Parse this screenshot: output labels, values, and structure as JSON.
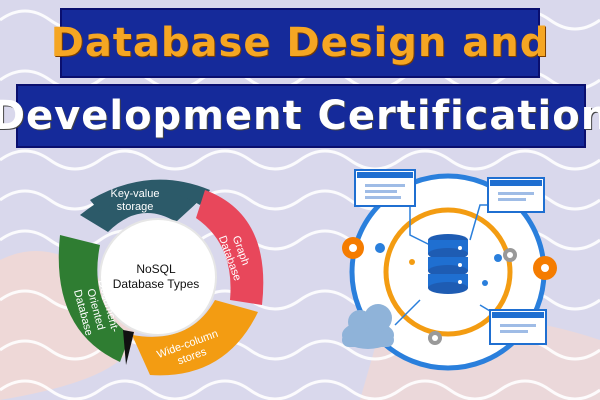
{
  "title": {
    "line1": "Database Design and",
    "line2": "Development Certification"
  },
  "nosql_diagram": {
    "center": "NoSQL Database Types",
    "segments": [
      {
        "label": "Key-value storage",
        "color": "#2c5a69"
      },
      {
        "label": "Graph Database",
        "color": "#e8475b"
      },
      {
        "label": "Wide-column stores",
        "color": "#f39c12"
      },
      {
        "label": "Document-Oriented Database",
        "color": "#2f7d32"
      }
    ]
  },
  "colors": {
    "banner": "#152a9a",
    "title_accent": "#f5a623",
    "network_blue": "#1f6fd1",
    "gear_orange": "#f57c00"
  },
  "network_illustration": {
    "icons": [
      "database-icon",
      "monitor-icon",
      "cloud-icon",
      "gear-icon"
    ]
  }
}
